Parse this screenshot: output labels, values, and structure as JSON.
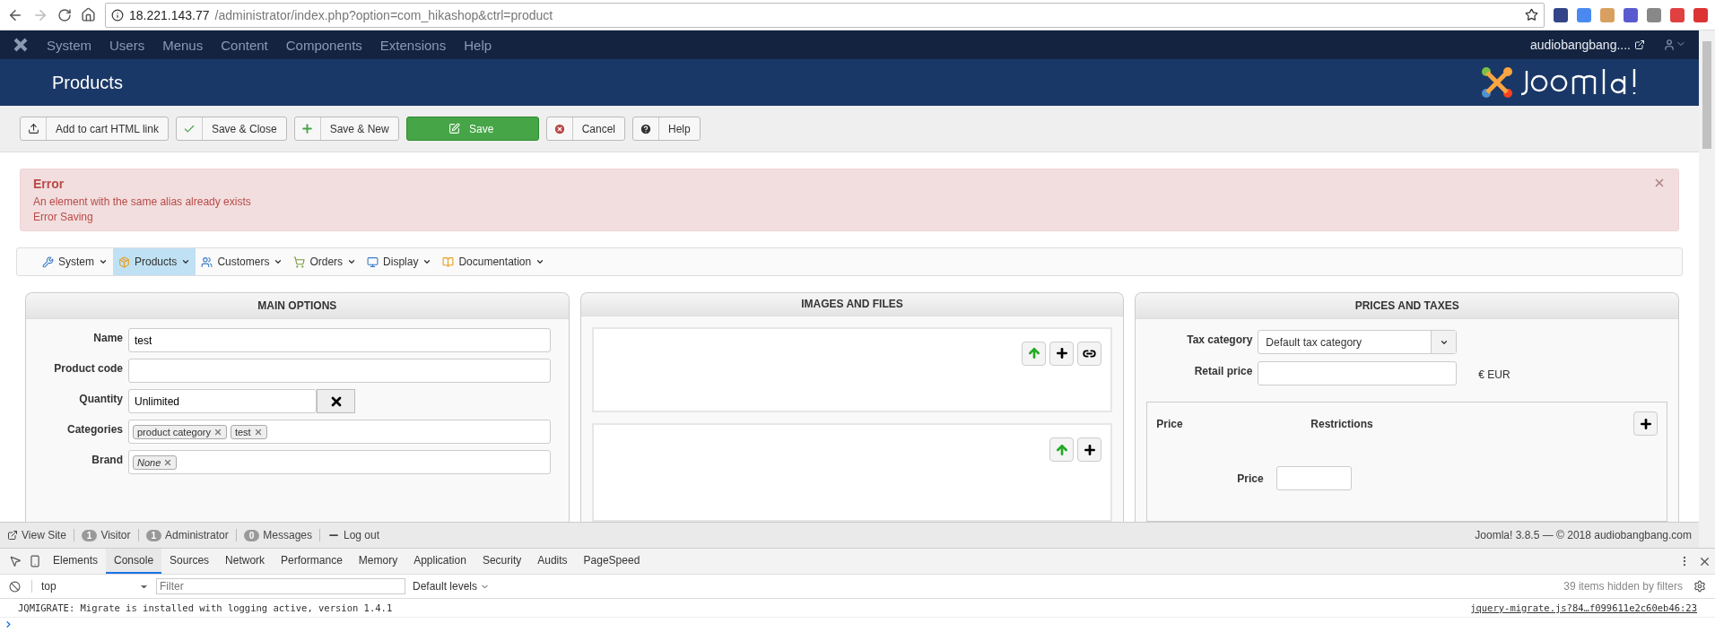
{
  "browser": {
    "url_host": "18.221.143.77",
    "url_path": "/administrator/index.php?option=com_hikashop&ctrl=product"
  },
  "top_nav": {
    "items": [
      "System",
      "Users",
      "Menus",
      "Content",
      "Components",
      "Extensions",
      "Help"
    ],
    "site_link": "audiobangbang...."
  },
  "header": {
    "title": "Products"
  },
  "toolbar": {
    "buttons": [
      {
        "label": "Add to cart HTML link",
        "kind": "default"
      },
      {
        "label": "Save & Close",
        "kind": "default"
      },
      {
        "label": "Save & New",
        "kind": "default"
      },
      {
        "label": "Save",
        "kind": "primary"
      },
      {
        "label": "Cancel",
        "kind": "default"
      },
      {
        "label": "Help",
        "kind": "default"
      }
    ]
  },
  "alert": {
    "heading": "Error",
    "messages": [
      "An element with the same alias already exists",
      "Error Saving"
    ]
  },
  "hika_menu": {
    "items": [
      {
        "label": "System",
        "selected": false
      },
      {
        "label": "Products",
        "selected": true
      },
      {
        "label": "Customers",
        "selected": false
      },
      {
        "label": "Orders",
        "selected": false
      },
      {
        "label": "Display",
        "selected": false
      },
      {
        "label": "Documentation",
        "selected": false
      }
    ]
  },
  "main_options": {
    "title": "MAIN OPTIONS",
    "fields": [
      {
        "label": "Name",
        "kind": "text",
        "value": "test"
      },
      {
        "label": "Product code",
        "kind": "text"
      },
      {
        "label": "Quantity",
        "kind": "quantity",
        "value": "Unlimited"
      },
      {
        "label": "Categories",
        "kind": "tags",
        "tags": [
          {
            "label": "product category",
            "empty": false
          },
          {
            "label": "test",
            "empty": false
          }
        ]
      },
      {
        "label": "Brand",
        "kind": "tags",
        "tags": [
          {
            "label": "None",
            "empty": true
          }
        ]
      }
    ]
  },
  "images": {
    "title": "IMAGES AND FILES"
  },
  "prices": {
    "title": "PRICES AND TAXES",
    "tax_label": "Tax category",
    "tax_value": "Default tax category",
    "retail_label": "Retail price",
    "currency": "€ EUR",
    "table_columns": [
      "Price",
      "Restrictions"
    ],
    "row_label": "Price"
  },
  "status_bar": {
    "view_site": "View Site",
    "counters": [
      {
        "count": "1",
        "label": "Visitor"
      },
      {
        "count": "1",
        "label": "Administrator"
      },
      {
        "count": "0",
        "label": "Messages"
      }
    ],
    "logout": "Log out",
    "version": "Joomla! 3.8.5  —  © 2018 audiobangbang.com"
  },
  "devtools": {
    "tabs": [
      {
        "label": "Elements",
        "selected": false
      },
      {
        "label": "Console",
        "selected": true
      },
      {
        "label": "Sources",
        "selected": false
      },
      {
        "label": "Network",
        "selected": false
      },
      {
        "label": "Performance",
        "selected": false
      },
      {
        "label": "Memory",
        "selected": false
      },
      {
        "label": "Application",
        "selected": false
      },
      {
        "label": "Security",
        "selected": false
      },
      {
        "label": "Audits",
        "selected": false
      },
      {
        "label": "PageSpeed",
        "selected": false
      }
    ],
    "context": "top",
    "filter_placeholder": "Filter",
    "levels": "Default levels",
    "hidden_note": "39 items hidden by filters",
    "messages": [
      {
        "text": "JQMIGRATE: Migrate is installed with logging active, version 1.4.1",
        "source": "jquery-migrate.js?84…f099611e2c60eb46:23"
      }
    ]
  }
}
